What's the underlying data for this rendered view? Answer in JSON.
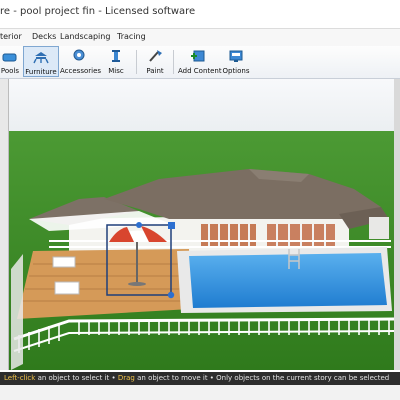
{
  "window": {
    "title": "re - pool project fin - Licensed software"
  },
  "menu": {
    "tabs": [
      "terior",
      "Decks",
      "Landscaping",
      "Tracing"
    ]
  },
  "toolbar": {
    "buttons": [
      {
        "label": "Pools",
        "icon": "pool-icon"
      },
      {
        "label": "Furniture",
        "icon": "furniture-icon",
        "active": true
      },
      {
        "label": "Accessories",
        "icon": "accessories-icon"
      },
      {
        "label": "Misc",
        "icon": "misc-icon"
      },
      {
        "label": "Paint",
        "icon": "paint-icon"
      },
      {
        "label": "Add Content",
        "icon": "add-content-icon"
      },
      {
        "label": "Options",
        "icon": "options-icon"
      }
    ]
  },
  "status": {
    "part1": "Left-click",
    "part2": " an object to select it • ",
    "part3": "Drag",
    "part4": " an object to move it • Only objects on the current story can be selected"
  },
  "colors": {
    "sky_top": "#f4f6f8",
    "grass": "#3f8a28",
    "roof": "#6e6458",
    "pool_water": "#2a8bd8",
    "deck": "#d9a25e",
    "selection": "#1f3f7a",
    "umbrella_red": "#d8452e"
  }
}
